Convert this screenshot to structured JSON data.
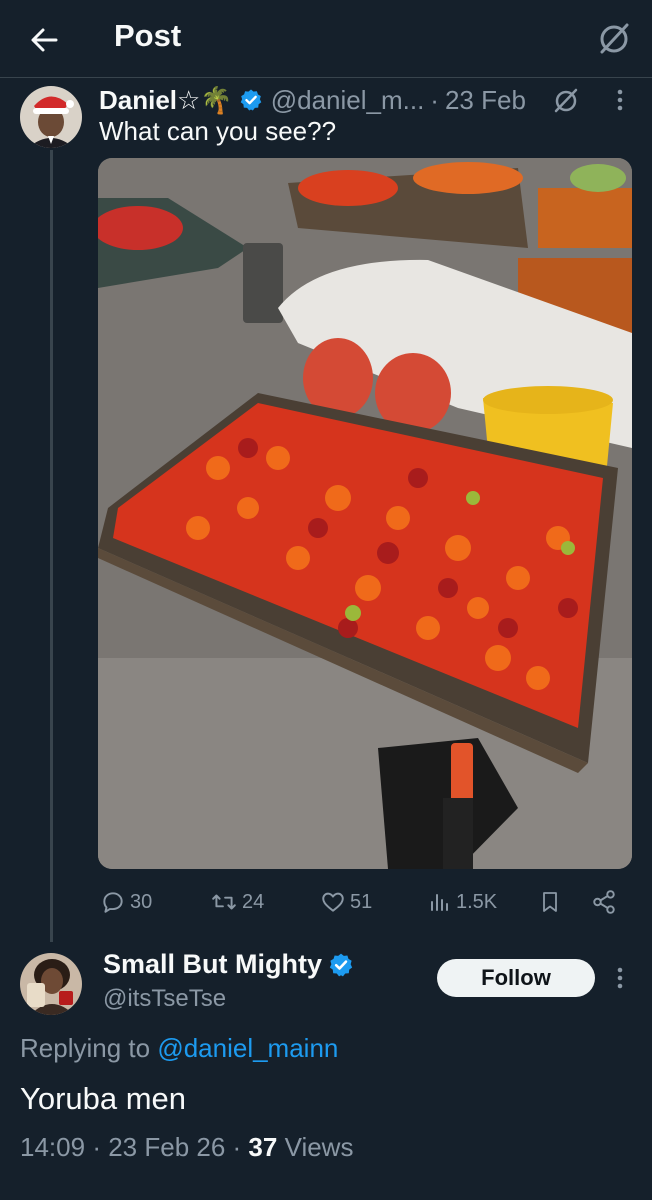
{
  "header": {
    "title": "Post",
    "back_icon": "arrow-left-icon",
    "grok_icon": "grok-icon"
  },
  "post": {
    "display_name": "Daniel☆🌴",
    "handle": "@daniel_m...",
    "separator": "·",
    "date": "23 Feb",
    "text": "What can you see??",
    "image_description_icon": "market-photo",
    "actions": {
      "replies": "30",
      "reposts": "24",
      "likes": "51",
      "views": "1.5K"
    }
  },
  "reply": {
    "display_name": "Small But Mighty",
    "handle": "@itsTseTse",
    "follow_label": "Follow",
    "replying_prefix": "Replying to",
    "replying_handle": "@daniel_mainn",
    "text": "Yoruba men",
    "time": "14:09",
    "date": "23 Feb 26",
    "views_count": "37",
    "views_label": "Views"
  },
  "colors": {
    "background": "#15202b",
    "text": "#f7f9f9",
    "muted": "#8b98a5",
    "accent": "#1d9bf0",
    "border": "#38444d"
  }
}
